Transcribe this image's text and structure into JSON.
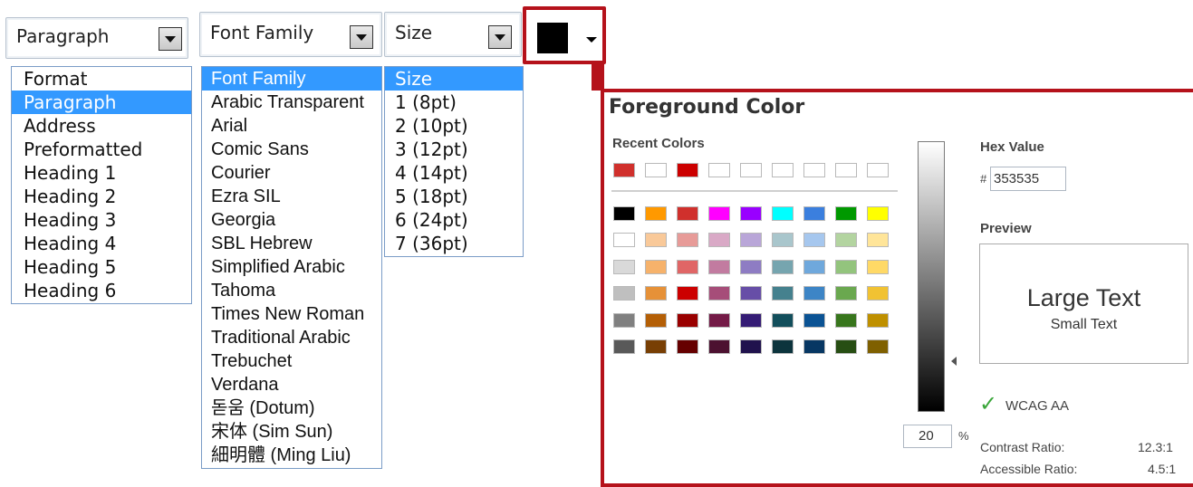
{
  "paragraph_combo": {
    "value": "Paragraph"
  },
  "font_combo": {
    "value": "Font Family"
  },
  "size_combo": {
    "value": "Size"
  },
  "format_list": [
    "Format",
    "Paragraph",
    "Address",
    "Preformatted",
    "Heading 1",
    "Heading 2",
    "Heading 3",
    "Heading 4",
    "Heading 5",
    "Heading 6"
  ],
  "format_selected": 1,
  "font_list": [
    "Font Family",
    "Arabic Transparent",
    "Arial",
    "Comic Sans",
    "Courier",
    "Ezra SIL",
    "Georgia",
    "SBL Hebrew",
    "Simplified Arabic",
    "Tahoma",
    "Times New Roman",
    "Traditional Arabic",
    "Trebuchet",
    "Verdana",
    "돋움 (Dotum)",
    "宋体 (Sim Sun)",
    "細明體 (Ming Liu)"
  ],
  "font_selected": 0,
  "size_list": [
    "Size",
    "1 (8pt)",
    "2 (10pt)",
    "3 (12pt)",
    "4 (14pt)",
    "5 (18pt)",
    "6 (24pt)",
    "7 (36pt)"
  ],
  "size_selected": 0,
  "color_button": {
    "color": "#000000"
  },
  "panel": {
    "title": "Foreground Color",
    "recent_label": "Recent Colors",
    "recent_colors": [
      "#d0302c",
      "#ffffff",
      "#cc0000",
      "#ffffff",
      "#ffffff",
      "#ffffff",
      "#ffffff",
      "#ffffff",
      "#ffffff"
    ],
    "palette": [
      [
        "#000000",
        "#ff9900",
        "#d0302c",
        "#ff00ff",
        "#9900ff",
        "#00ffff",
        "#3b7fde",
        "#009900",
        "#ffff00"
      ],
      [
        "#ffffff",
        "#f9c999",
        "#e79b98",
        "#d9a9c6",
        "#b9a6d8",
        "#a9c6cc",
        "#a6c7ee",
        "#b3d4a0",
        "#ffe599"
      ],
      [
        "#d9d9d9",
        "#f6b26b",
        "#e06666",
        "#c27ba0",
        "#8e7cc3",
        "#76a5af",
        "#6fa8dc",
        "#93c47d",
        "#ffd966"
      ],
      [
        "#bfbfbf",
        "#e69138",
        "#cc0000",
        "#a64d79",
        "#674ea7",
        "#45818e",
        "#3d85c6",
        "#6aa84f",
        "#f1c232"
      ],
      [
        "#808080",
        "#b45f06",
        "#990000",
        "#741b47",
        "#351c75",
        "#134f5c",
        "#0b5394",
        "#38761d",
        "#bf9000"
      ],
      [
        "#595959",
        "#783f04",
        "#660000",
        "#4c1130",
        "#20124d",
        "#0c343d",
        "#073763",
        "#274e13",
        "#7f6000"
      ]
    ],
    "hex_label": "Hex Value",
    "hex_prefix": "#",
    "hex_value": "353535",
    "preview_label": "Preview",
    "preview_large": "Large Text",
    "preview_small": "Small Text",
    "preview_color": "#353535",
    "percent_value": "20",
    "percent_symbol": "%",
    "wcag_check": "✓",
    "wcag_label": "WCAG AA",
    "contrast_label": "Contrast Ratio:",
    "contrast_value": "12.3:1",
    "accessible_label": "Accessible Ratio:",
    "accessible_value": "4.5:1",
    "accent": "#b5121b",
    "check_color": "#3aa63a"
  }
}
